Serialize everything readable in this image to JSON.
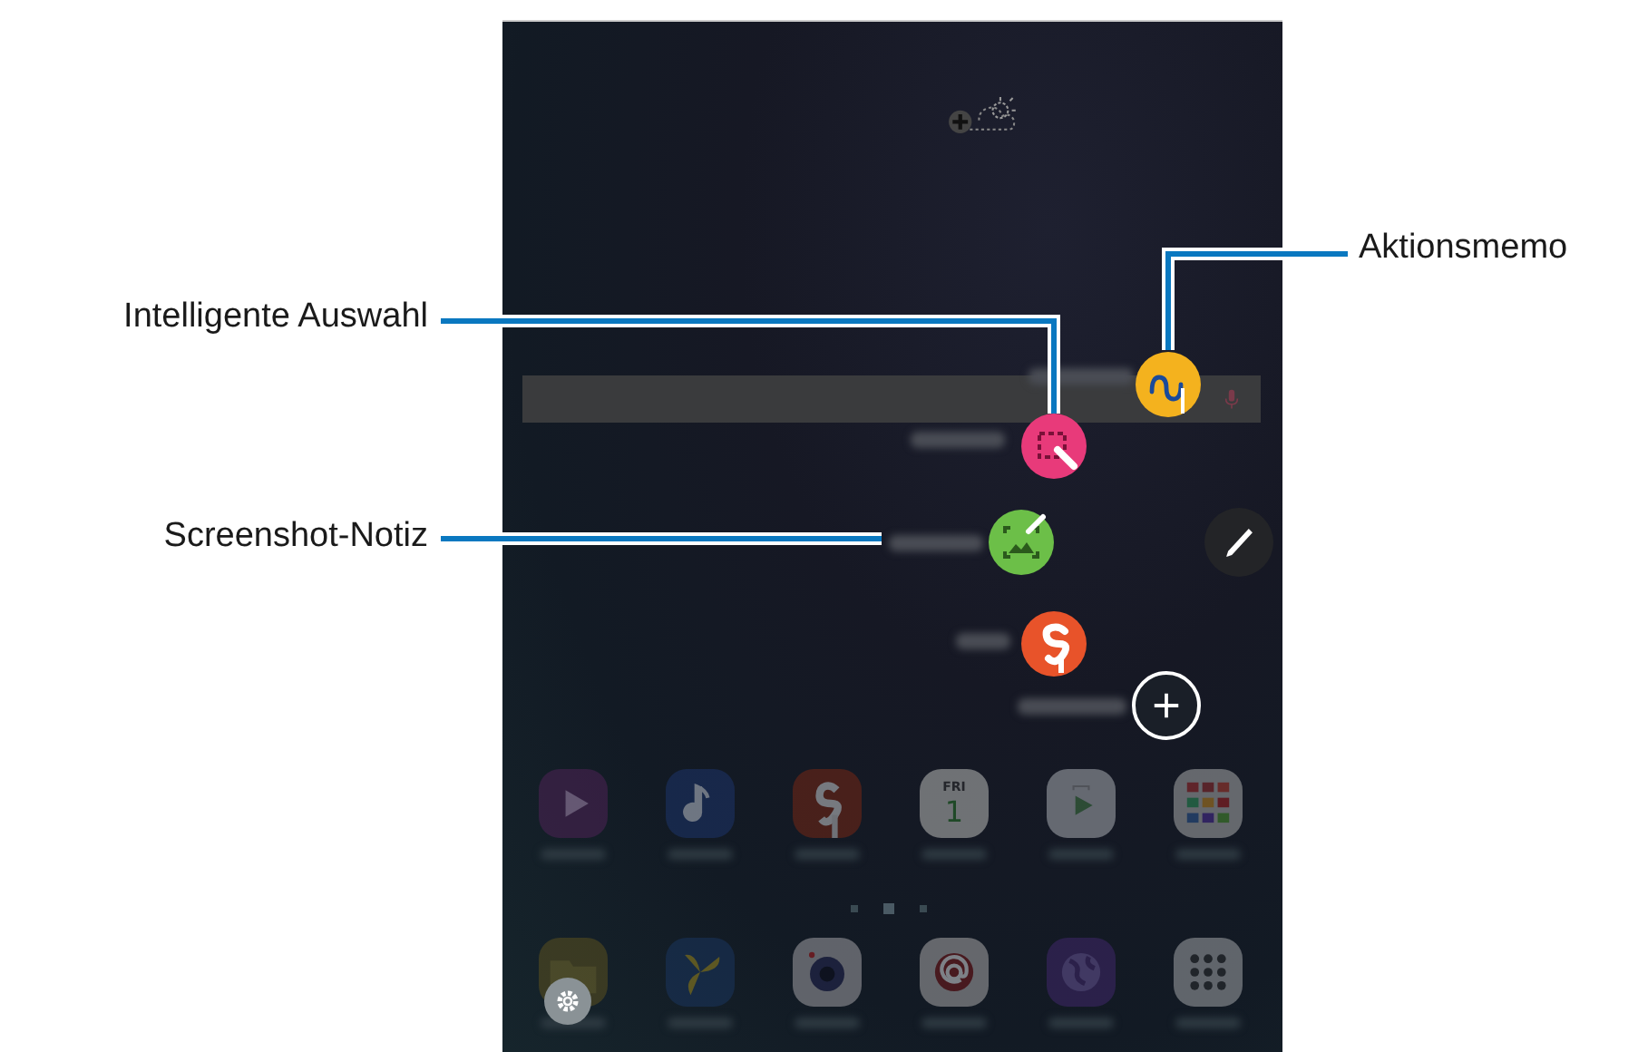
{
  "callouts": [
    {
      "label": "Aktionsmemo",
      "kind": "right"
    },
    {
      "label": "Intelligente Auswahl",
      "kind": "left"
    },
    {
      "label": "Screenshot-Notiz",
      "kind": "left"
    }
  ],
  "pen_menu": [
    {
      "kind": "action-memo"
    },
    {
      "kind": "smart-select"
    },
    {
      "kind": "screen-write"
    },
    {
      "kind": "s-note"
    },
    {
      "kind": "add"
    }
  ],
  "home_apps": [
    {
      "kind": "video"
    },
    {
      "kind": "music"
    },
    {
      "kind": "s-note"
    },
    {
      "kind": "calendar",
      "weekday": "FRI",
      "day": "1"
    },
    {
      "kind": "store"
    },
    {
      "kind": "folder"
    },
    {
      "kind": "files"
    },
    {
      "kind": "gallery"
    },
    {
      "kind": "camera"
    },
    {
      "kind": "email"
    },
    {
      "kind": "internet"
    },
    {
      "kind": "apps"
    }
  ]
}
